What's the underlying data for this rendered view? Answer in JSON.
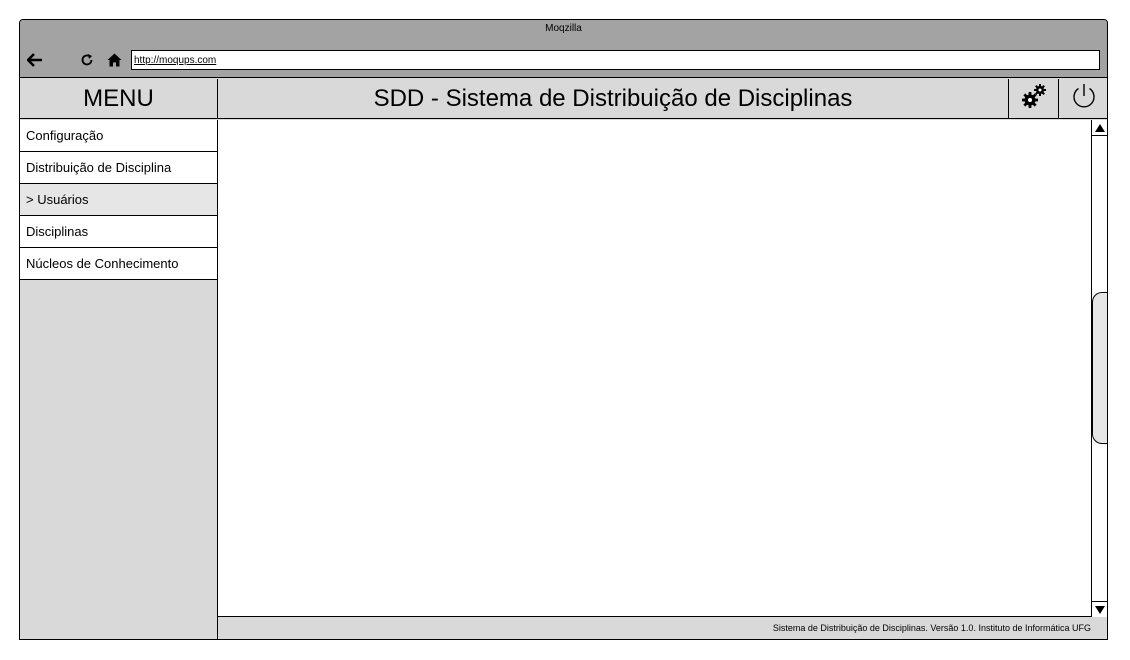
{
  "browser": {
    "title": "Moqzilla",
    "url": "http://moqups.com",
    "icons": [
      "back-arrow-icon",
      "reload-icon",
      "home-icon"
    ]
  },
  "menu": {
    "title": "MENU",
    "items": [
      {
        "label": "Configuração",
        "active": false
      },
      {
        "label": "Distribuição de Disciplina",
        "active": false
      },
      {
        "label": "> Usuários",
        "active": true
      },
      {
        "label": "Disciplinas",
        "active": false
      },
      {
        "label": "Núcleos de Conhecimento",
        "active": false
      }
    ]
  },
  "header": {
    "title": "SDD - Sistema de Distribuição de Disciplinas",
    "icons": [
      "settings-gears-icon",
      "power-icon"
    ]
  },
  "footer": {
    "text": "Sistema de Distribuição de Disciplinas. Versão 1.0. Instituto de Informática UFG"
  },
  "colors": {
    "chrome": "#a3a3a3",
    "panel": "#d9d9d9",
    "active_item": "#e6e6e6",
    "content": "#ffffff"
  }
}
